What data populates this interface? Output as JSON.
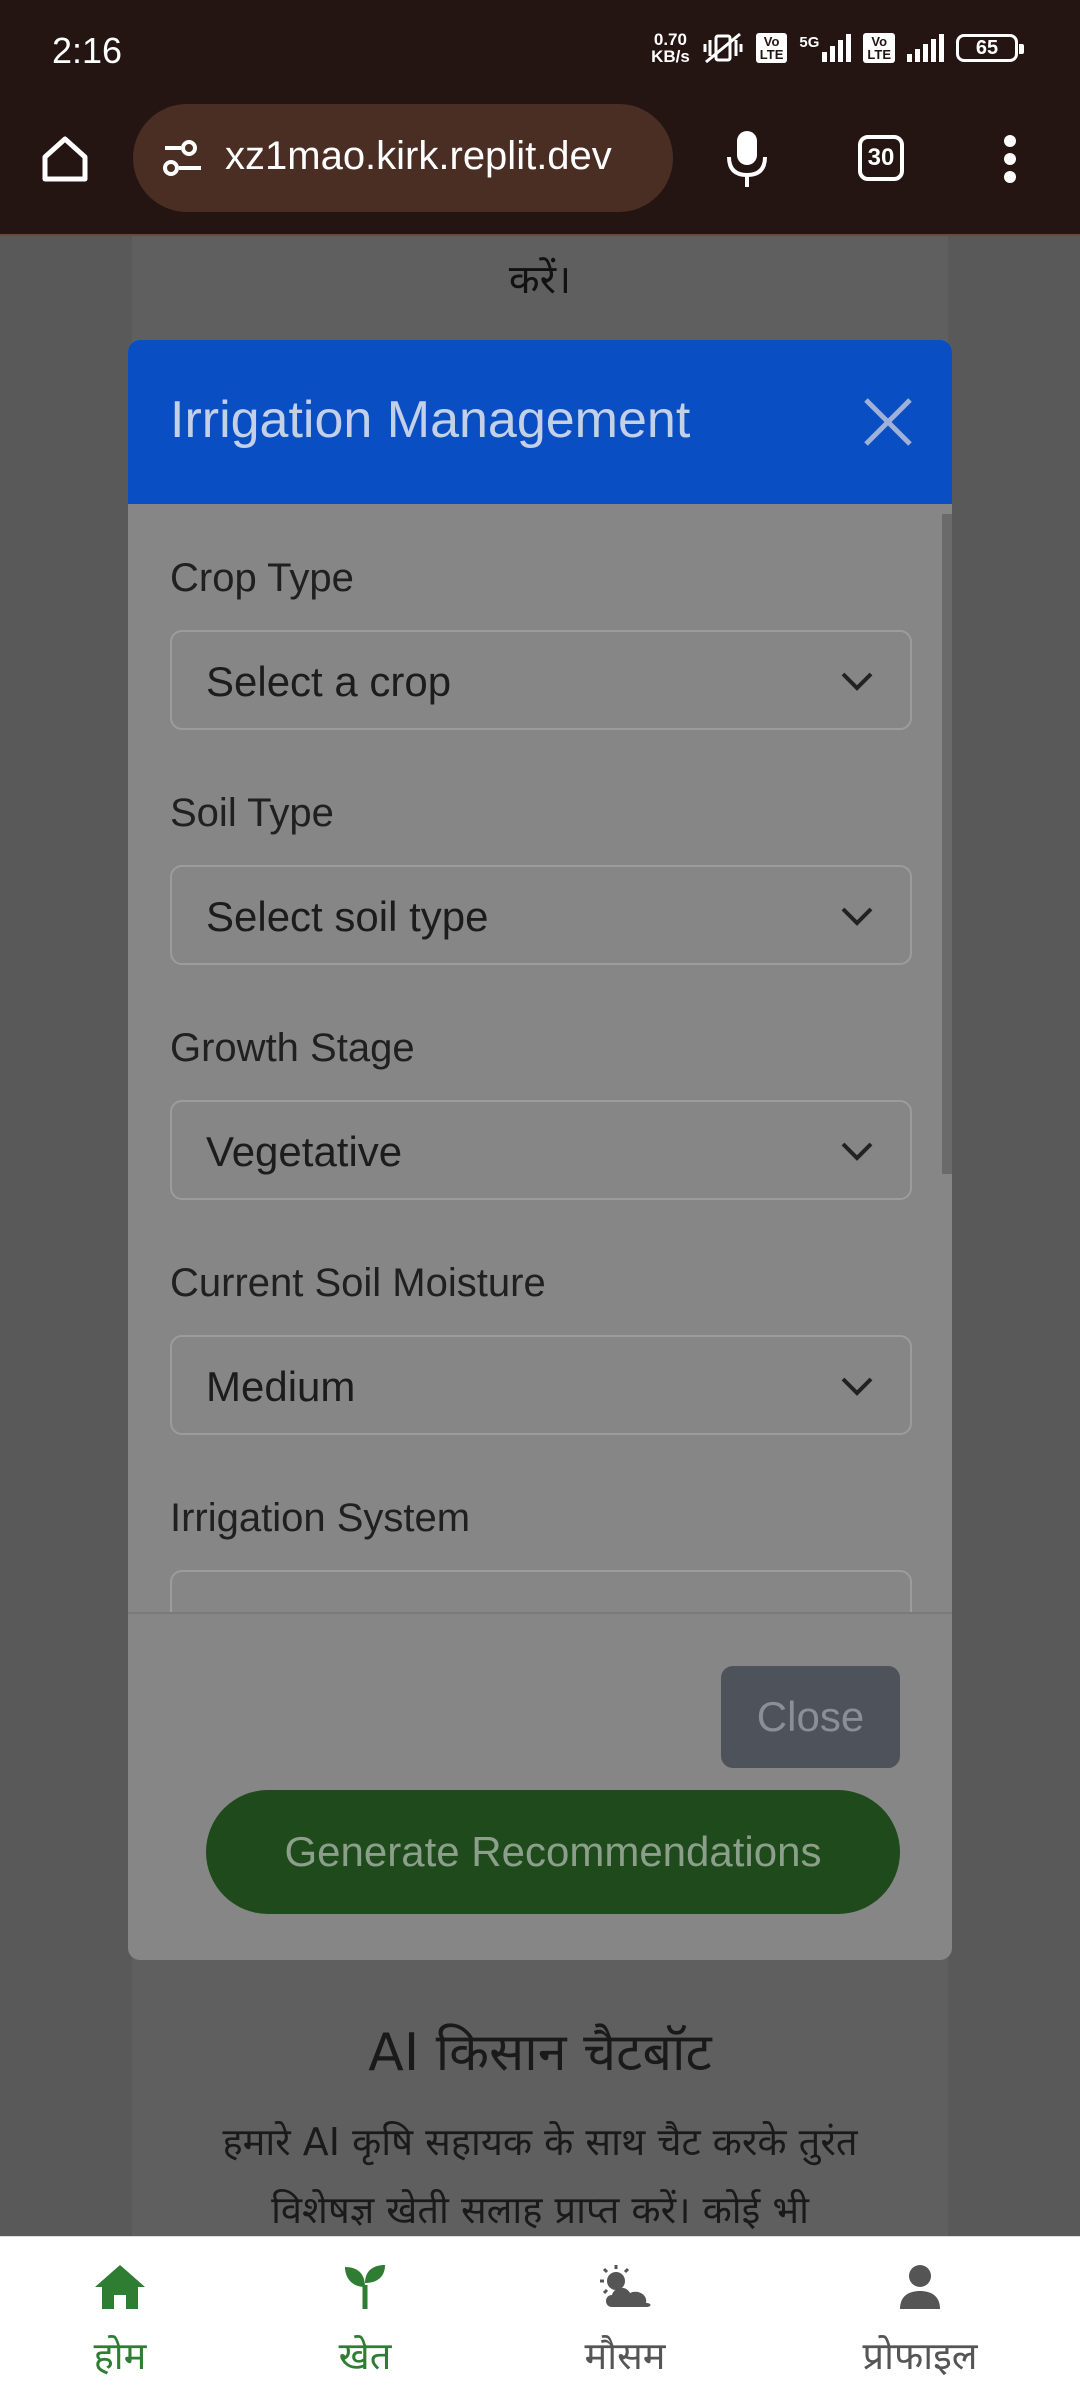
{
  "status_bar": {
    "time": "2:16",
    "net_speed_value": "0.70",
    "net_speed_unit": "KB/s",
    "network_type": "5G",
    "volte_label_top": "Vo",
    "volte_label_bottom": "LTE",
    "battery_level": "65",
    "icons": [
      "mute-vibrate-icon",
      "volte-icon",
      "signal-icon",
      "volte-icon",
      "signal-icon",
      "battery-icon"
    ]
  },
  "browser": {
    "url": "xz1mao.kirk.replit.dev",
    "tab_count": "30",
    "icons": [
      "home-icon",
      "site-settings-icon",
      "mic-icon",
      "tabs-icon",
      "more-vert-icon"
    ]
  },
  "background_page": {
    "top_text": "करें।",
    "chatbot_title": "AI किसान चैटबॉट",
    "chatbot_description": "हमारे AI कृषि सहायक के साथ चैट करके तुरंत विशेषज्ञ खेती सलाह प्राप्त करें। कोई भी"
  },
  "modal": {
    "title": "Irrigation Management",
    "fields": [
      {
        "label": "Crop Type",
        "value": "Select a crop"
      },
      {
        "label": "Soil Type",
        "value": "Select soil type"
      },
      {
        "label": "Growth Stage",
        "value": "Vegetative"
      },
      {
        "label": "Current Soil Moisture",
        "value": "Medium"
      },
      {
        "label": "Irrigation System",
        "value": ""
      }
    ],
    "close_label": "Close",
    "generate_label": "Generate Recommendations"
  },
  "bottom_nav": {
    "items": [
      {
        "label": "होम",
        "icon": "home-icon",
        "color": "#2e7d32"
      },
      {
        "label": "खेत",
        "icon": "sprout-icon",
        "color": "#2e7d32"
      },
      {
        "label": "मौसम",
        "icon": "weather-icon",
        "color": "#555555"
      },
      {
        "label": "प्रोफाइल",
        "icon": "profile-icon",
        "color": "#555555"
      }
    ]
  },
  "colors": {
    "modal_header": "#0a4ec4",
    "generate_button": "#1f4b1c",
    "close_button": "#4e525a",
    "nav_active": "#2e7d32"
  }
}
